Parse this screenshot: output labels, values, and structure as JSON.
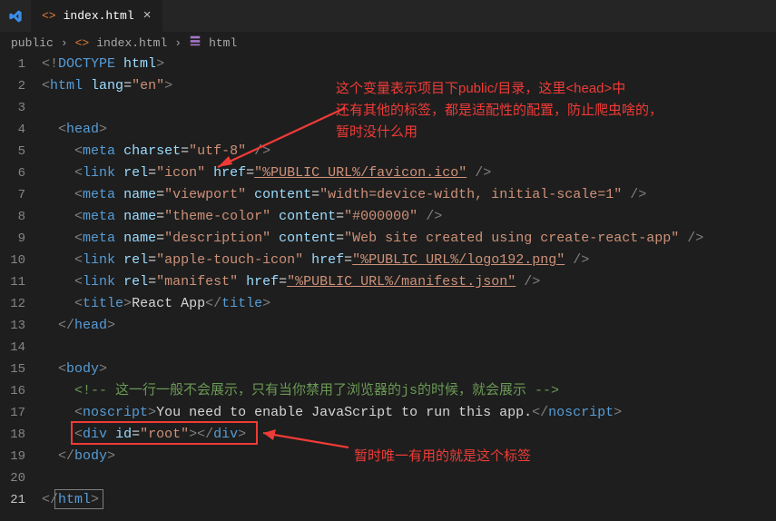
{
  "tab": {
    "filename": "index.html"
  },
  "breadcrumbs": {
    "folder": "public",
    "file": "index.html",
    "symbol": "html"
  },
  "code_tokens": {
    "doctype_html": "html",
    "lang": "lang",
    "lang_val": "\"en\"",
    "head": "head",
    "charset": "charset",
    "charset_val": "\"utf-8\"",
    "rel": "rel",
    "rel_icon": "\"icon\"",
    "href": "href",
    "favicon_val": "\"%PUBLIC_URL%/favicon.ico\"",
    "name": "name",
    "content": "content",
    "viewport": "\"viewport\"",
    "viewport_val": "\"width=device-width, initial-scale=1\"",
    "themecolor": "\"theme-color\"",
    "themecolor_val": "\"#000000\"",
    "description": "\"description\"",
    "description_val": "\"Web site created using create-react-app\"",
    "apple": "\"apple-touch-icon\"",
    "apple_href": "\"%PUBLIC_URL%/logo192.png\"",
    "manifest": "\"manifest\"",
    "manifest_href": "\"%PUBLIC_URL%/manifest.json\"",
    "title_text": "React App",
    "body": "body",
    "comment": "<!-- 这一行一般不会展示，只有当你禁用了浏览器的js的时候，就会展示 -->",
    "noscript_text": "You need to enable JavaScript to run this app.",
    "id": "id",
    "root": "\"root\""
  },
  "annotations": {
    "top": "这个变量表示项目下public/目录，这里<head>中\n还有其他的标签，都是适配性的配置，防止爬虫啥的，\n暂时没什么用",
    "bottom": "暂时唯一有用的就是这个标签"
  },
  "line_count": 21
}
